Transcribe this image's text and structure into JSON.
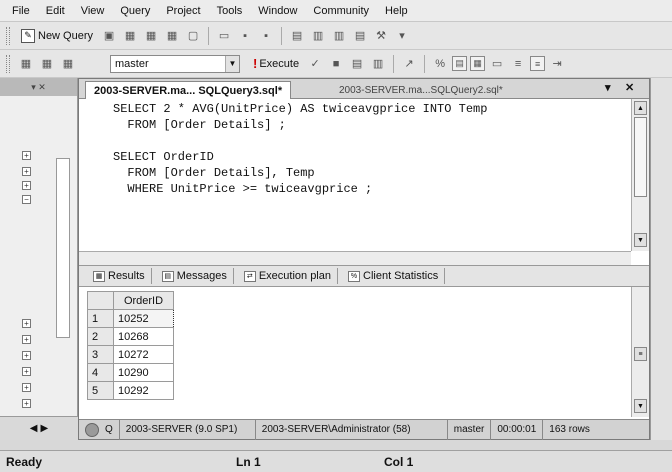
{
  "menu": [
    "File",
    "Edit",
    "View",
    "Query",
    "Project",
    "Tools",
    "Window",
    "Community",
    "Help"
  ],
  "toolbar": {
    "new_query": "New Query",
    "database": "master",
    "execute": "Execute"
  },
  "tabs": {
    "active": "2003-SERVER.ma... SQLQuery3.sql*",
    "inactive": "2003-SERVER.ma...SQLQuery2.sql*",
    "pin": "▾",
    "close": "✕"
  },
  "code": [
    "SELECT 2 * AVG(UnitPrice) AS twiceavgprice INTO Temp",
    "  FROM [Order Details] ;",
    "",
    "SELECT OrderID",
    "  FROM [Order Details], Temp",
    "  WHERE UnitPrice >= twiceavgprice ;"
  ],
  "results_tabs": {
    "results": "Results",
    "messages": "Messages",
    "plan": "Execution plan",
    "stats": "Client Statistics"
  },
  "grid": {
    "header": "OrderID",
    "rows": [
      {
        "n": "1",
        "v": "10252"
      },
      {
        "n": "2",
        "v": "10268"
      },
      {
        "n": "3",
        "v": "10272"
      },
      {
        "n": "4",
        "v": "10290"
      },
      {
        "n": "5",
        "v": "10292"
      }
    ]
  },
  "query_status": {
    "prefix": "Q",
    "server": "2003-SERVER (9.0 SP1)",
    "user": "2003-SERVER\\Administrator (58)",
    "db": "master",
    "time": "00:00:01",
    "rows": "163 rows"
  },
  "status": {
    "ready": "Ready",
    "line": "Ln 1",
    "col": "Col 1"
  }
}
